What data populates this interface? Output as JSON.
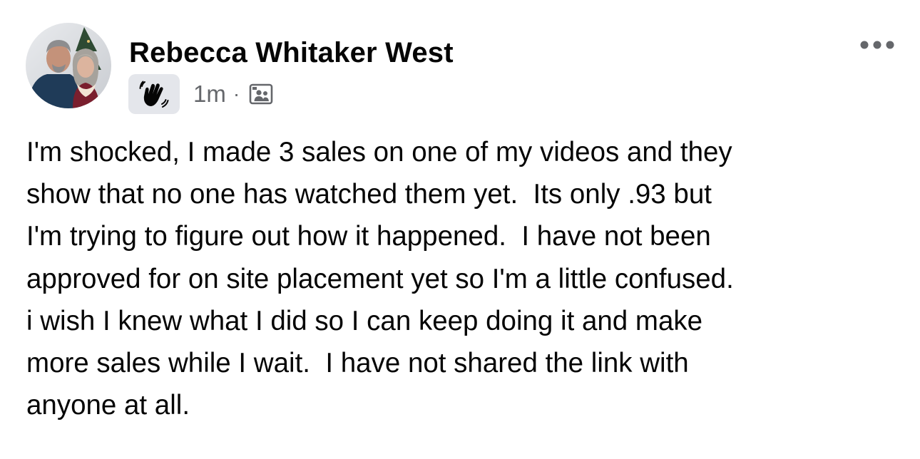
{
  "post": {
    "author_name": "Rebecca Whitaker West",
    "badge_icon": "waving-hand-icon",
    "timestamp": "1m",
    "separator": "·",
    "audience_icon": "group-audience-icon",
    "more_icon": "more-options-icon",
    "body_lines": [
      "I'm shocked, I made 3 sales on one of my videos and they",
      "show that no one has watched them yet.  Its only .93 but",
      "I'm trying to figure out how it happened.  I have not been",
      "approved for on site placement yet so I'm a little confused.",
      "i wish I knew what I did so I can keep doing it and make",
      "more sales while I wait.  I have not shared the link with",
      "anyone at all."
    ]
  },
  "colors": {
    "text_primary": "#050505",
    "text_secondary": "#65676b",
    "badge_background": "#e4e6eb"
  }
}
